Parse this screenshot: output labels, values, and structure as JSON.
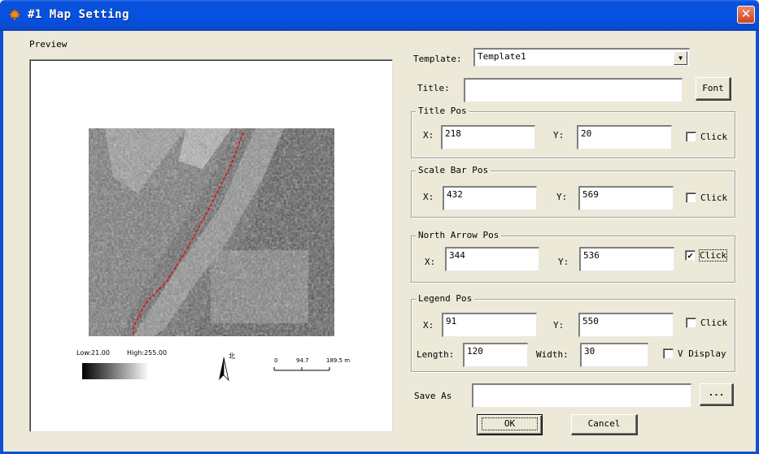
{
  "window": {
    "title": "#1 Map Setting",
    "close_glyph": "✕",
    "app_icon": "maple-leaf-icon"
  },
  "preview": {
    "label": "Preview",
    "legend_low": "Low:21.00",
    "legend_high": "High:255.00",
    "scale_ticks": [
      "0",
      "94.7",
      "189.5 m"
    ],
    "north_label": "北"
  },
  "template": {
    "label": "Template:",
    "value": "Template1"
  },
  "title_field": {
    "label": "Title:",
    "value": "",
    "font_button": "Font"
  },
  "title_pos": {
    "group": "Title Pos",
    "x_label": "X:",
    "x": "218",
    "y_label": "Y:",
    "y": "20",
    "click_label": "Click",
    "checked": false
  },
  "scale_bar_pos": {
    "group": "Scale Bar Pos",
    "x_label": "X:",
    "x": "432",
    "y_label": "Y:",
    "y": "569",
    "click_label": "Click",
    "checked": false
  },
  "north_arrow_pos": {
    "group": "North Arrow Pos",
    "x_label": "X:",
    "x": "344",
    "y_label": "Y:",
    "y": "536",
    "click_label": "Click",
    "checked": true,
    "check_glyph": "✔"
  },
  "legend_pos": {
    "group": "Legend Pos",
    "x_label": "X:",
    "x": "91",
    "y_label": "Y:",
    "y": "550",
    "click_label": "Click",
    "checked": false,
    "length_label": "Length:",
    "length": "120",
    "width_label": "Width:",
    "width": "30",
    "vdisplay_label": "V Display",
    "vdisplay_checked": false
  },
  "save_as": {
    "label": "Save As",
    "value": "",
    "browse": "..."
  },
  "buttons": {
    "ok": "OK",
    "cancel": "Cancel"
  },
  "colors": {
    "titlebar": "#0552e3",
    "dialog_bg": "#ece9d8",
    "close": "#d3421e"
  }
}
